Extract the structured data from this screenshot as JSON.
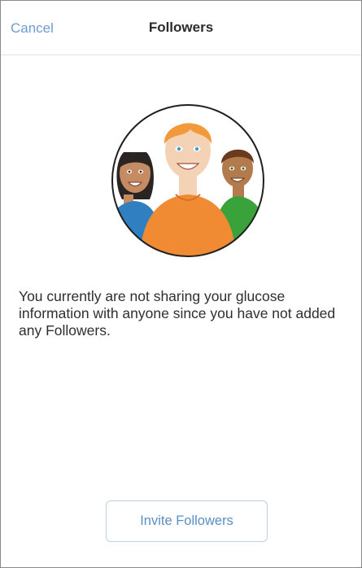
{
  "navbar": {
    "cancel_label": "Cancel",
    "title": "Followers"
  },
  "illustration": {
    "icon": "followers-group-illustration"
  },
  "message": "You currently are not sharing your glucose information with anyone since you have not added any Followers.",
  "invite_button": {
    "label": "Invite Followers"
  },
  "colors": {
    "accent": "#6b9ed1",
    "button_border": "#bcd0e4",
    "shirt_center": "#f08a33",
    "shirt_left": "#2f7fc1",
    "shirt_right": "#3aa23a"
  }
}
